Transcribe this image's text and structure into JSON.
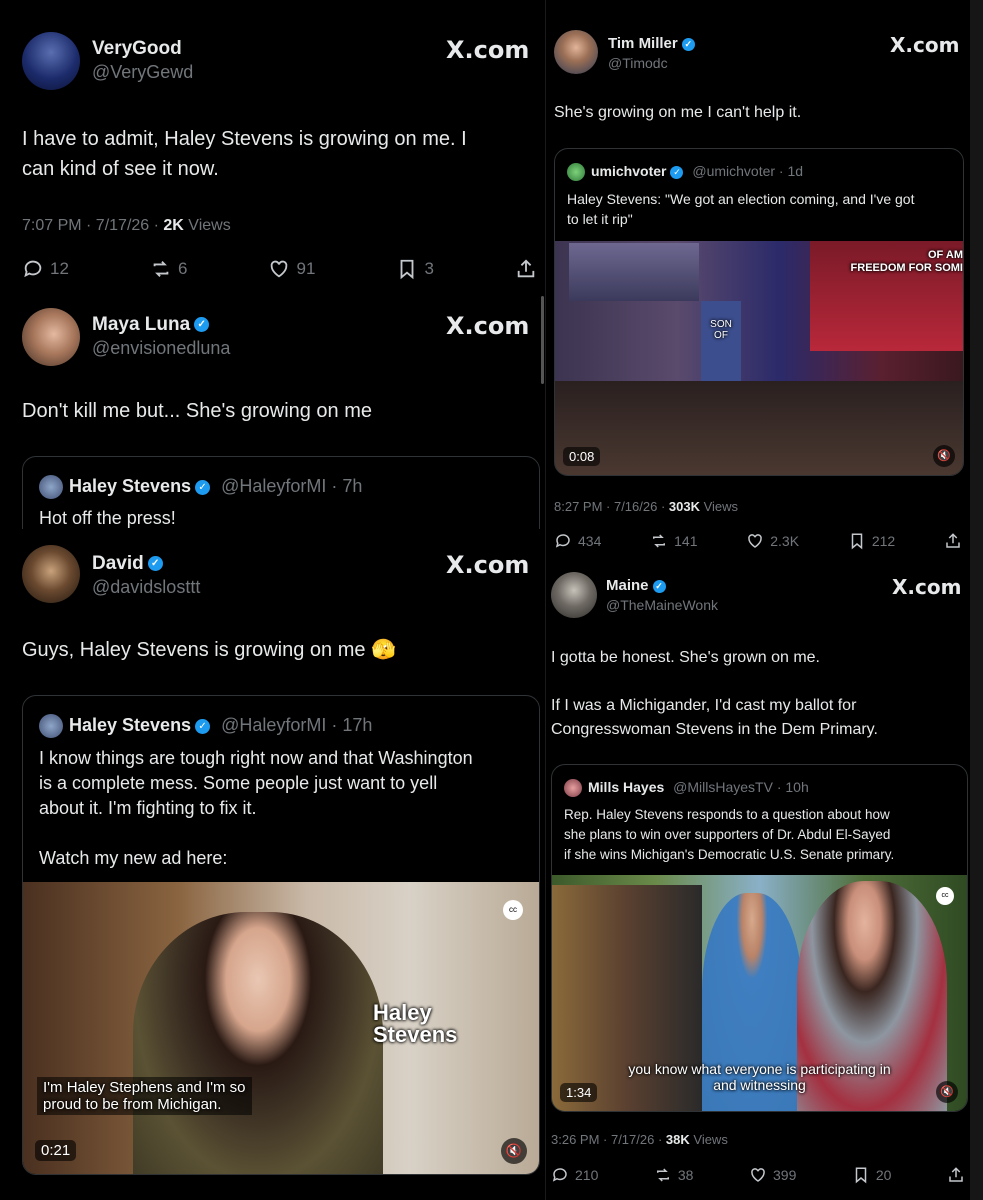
{
  "tweet1": {
    "name": "VeryGood",
    "handle": "@VeryGewd",
    "site": "X.com",
    "text": "I have to admit, Haley Stevens is growing on me. I\ncan kind of see it now.",
    "time": "7:07 PM · 7/17/26 · ",
    "views": "2K",
    "views_label": " Views",
    "replies": "12",
    "reposts": "6",
    "likes": "91",
    "bookmarks": "3"
  },
  "tweet2": {
    "name": "Maya Luna",
    "handle": "@envisionedluna",
    "site": "X.com",
    "text": "Don't kill me but... She's growing on me",
    "quote": {
      "name": "Haley Stevens",
      "handle": "@HaleyforMI · 7h",
      "text": "Hot off the press!"
    }
  },
  "tweet3": {
    "name": "David",
    "handle": "@davidslosttt",
    "site": "X.com",
    "text": "Guys, Haley Stevens is growing on me 🫣",
    "quote": {
      "name": "Haley Stevens",
      "handle": "@HaleyforMI · 17h",
      "text": "I know things are tough right now and that Washington\nis a complete mess. Some people just want to yell\nabout it. I'm fighting to fix it.\n\nWatch my new ad here:",
      "video_overlay_title": "Haley\nStevens",
      "video_caption": "I'm Haley Stephens and I'm so\nproud to be from Michigan.",
      "duration": "0:21"
    }
  },
  "tweet4": {
    "name": "Tim Miller",
    "handle": "@Timodc",
    "site": "X.com",
    "text": "She's growing on me I can't help it.",
    "quote": {
      "name": "umichvoter",
      "handle": "@umichvoter · 1d",
      "text": "Haley Stevens: \"We got an election coming, and I've got\nto let it rip\"",
      "banner_text": "OF AM\nFREEDOM FOR SOMI",
      "sign_text": "SON\nOF",
      "duration": "0:08"
    },
    "time": "8:27 PM · 7/16/26 · ",
    "views": "303K",
    "views_label": " Views",
    "replies": "434",
    "reposts": "141",
    "likes": "2.3K",
    "bookmarks": "212"
  },
  "tweet5": {
    "name": "Maine",
    "handle": "@TheMaineWonk",
    "site": "X.com",
    "text": "I gotta be honest. She's grown on me.\n\nIf I was a Michigander, I'd cast my ballot for\nCongresswoman Stevens in the Dem Primary.",
    "quote": {
      "name": "Mills Hayes",
      "handle": "@MillsHayesTV · 10h",
      "text": "Rep. Haley Stevens responds to a question about how\nshe plans to win over supporters of Dr. Abdul El-Sayed\nif she wins Michigan's Democratic U.S. Senate primary.",
      "video_caption": "you know what everyone is participating in\nand witnessing",
      "duration": "1:34"
    },
    "time": "3:26 PM · 7/17/26 · ",
    "views": "38K",
    "views_label": " Views",
    "replies": "210",
    "reposts": "38",
    "likes": "399",
    "bookmarks": "20"
  }
}
